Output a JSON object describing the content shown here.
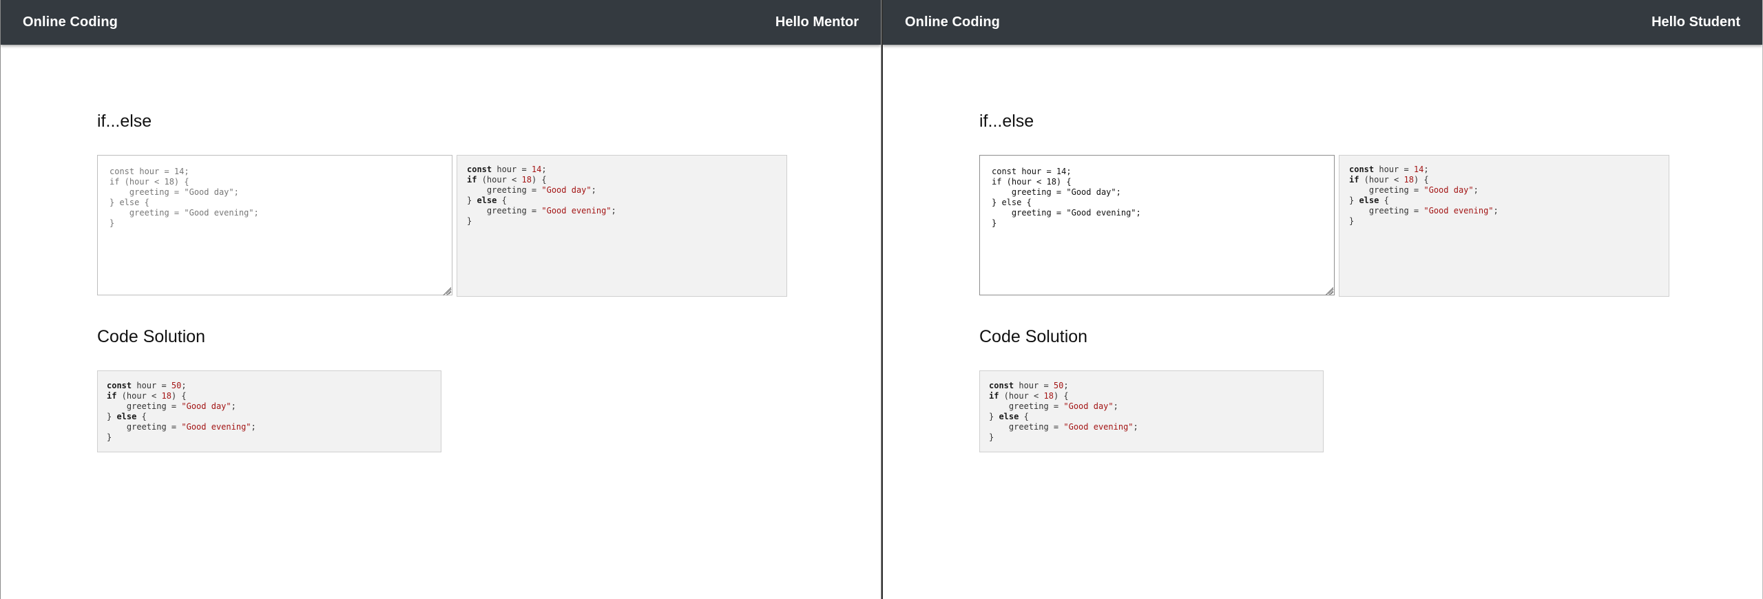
{
  "panes": [
    {
      "brand": "Online Coding",
      "greeting": "Hello Mentor",
      "block_title": "if...else",
      "editor_lines": [
        "const hour = 14;",
        "if (hour < 18) {",
        "    greeting = \"Good day\";",
        "} else {",
        "    greeting = \"Good evening\";",
        "}"
      ],
      "solution_title": "Code Solution"
    },
    {
      "brand": "Online Coding",
      "greeting": "Hello Student",
      "block_title": "if...else",
      "editor_lines": [
        "const hour = 14;",
        "if (hour < 18) {",
        "    greeting = \"Good day\";",
        "} else {",
        "    greeting = \"Good evening\";",
        "}"
      ],
      "solution_title": "Code Solution"
    }
  ],
  "preview": {
    "l1_kw": "const",
    "l1_rest": " hour = ",
    "l1_num": "14",
    "l1_end": ";",
    "l2_kw": "if",
    "l2_rest": " (hour < ",
    "l2_num": "18",
    "l2_end": ") {",
    "l3_pre": "    greeting = ",
    "l3_str": "\"Good day\"",
    "l3_end": ";",
    "l4_pre": "} ",
    "l4_kw": "else",
    "l4_end": " {",
    "l5_pre": "    greeting = ",
    "l5_str": "\"Good evening\"",
    "l5_end": ";",
    "l6": "}"
  },
  "solution": {
    "l1_kw": "const",
    "l1_rest": " hour = ",
    "l1_num": "50",
    "l1_end": ";",
    "l2_kw": "if",
    "l2_rest": " (hour < ",
    "l2_num": "18",
    "l2_end": ") {",
    "l3_pre": "    greeting = ",
    "l3_str": "\"Good day\"",
    "l3_end": ";",
    "l4_pre": "} ",
    "l4_kw": "else",
    "l4_end": " {",
    "l5_pre": "    greeting = ",
    "l5_str": "\"Good evening\"",
    "l5_end": ";",
    "l6": "}"
  },
  "colors": {
    "header_bg": "#343a40",
    "code_bg": "#f2f2f2",
    "string": "#a31515"
  }
}
